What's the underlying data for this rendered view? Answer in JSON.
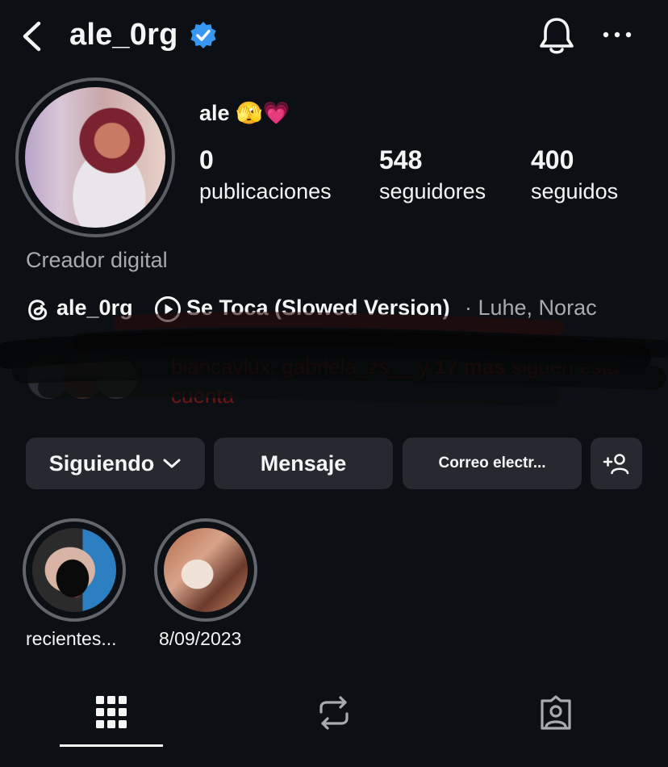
{
  "header": {
    "username": "ale_0rg",
    "verified_icon": "verified-badge-icon",
    "bell_icon": "bell-icon",
    "more_icon": "more-horizontal-icon",
    "back_icon": "chevron-left-icon"
  },
  "profile": {
    "display_name": "ale 🫣💗",
    "stats": {
      "posts": {
        "count": "0",
        "label": "publicaciones"
      },
      "followers": {
        "count": "548",
        "label": "seguidores"
      },
      "following": {
        "count": "400",
        "label": "seguidos"
      }
    },
    "category": "Creador digital",
    "threads_handle": "ale_0rg",
    "music": {
      "title": "Se Toca (Slowed Version)",
      "artist": "· Luhe, Norac"
    },
    "followed_by": {
      "names": "biancavlux, gabriela_zs__",
      "connector": " y ",
      "others": "17 más",
      "suffix": " siguen esta cuenta"
    }
  },
  "actions": {
    "following": "Siguiendo",
    "message": "Mensaje",
    "email": "Correo electr...",
    "add_user_icon": "add-person-icon"
  },
  "highlights": [
    {
      "label": "recientes..."
    },
    {
      "label": "8/09/2023"
    }
  ],
  "tabs": {
    "active": "grid",
    "icons": [
      "grid-icon",
      "reels-repost-icon",
      "tagged-icon"
    ]
  },
  "colors": {
    "background": "#0c1014",
    "button": "#262a30",
    "verified": "#3897f0",
    "secondary_text": "#a8aaad"
  }
}
